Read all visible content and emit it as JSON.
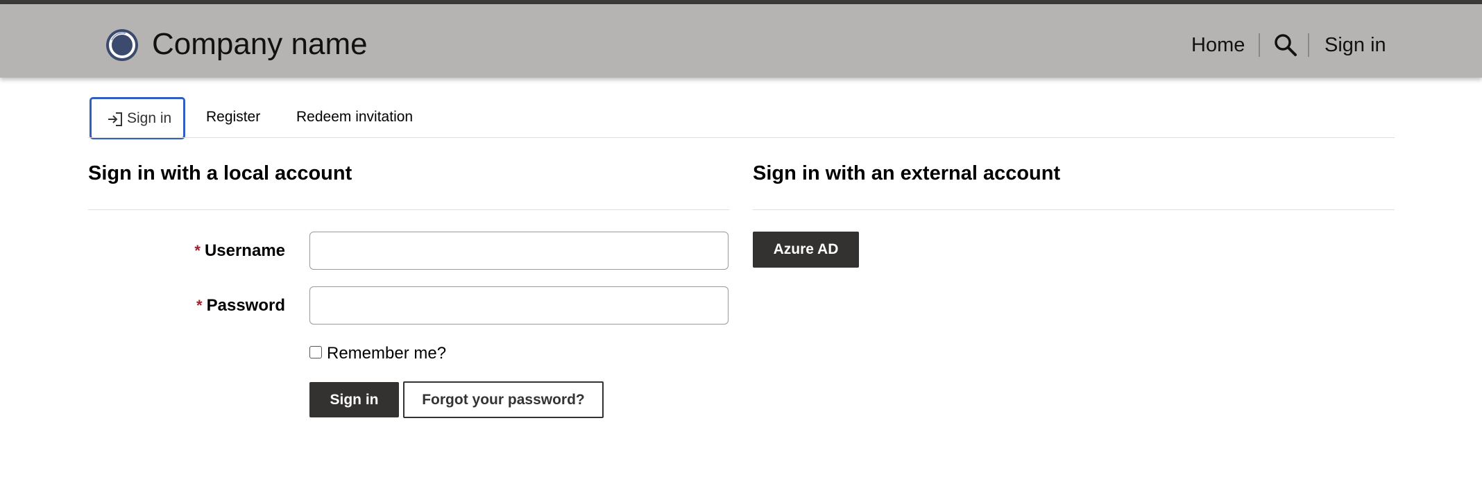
{
  "header": {
    "brand_name": "Company name",
    "nav": {
      "home": "Home",
      "sign_in": "Sign in"
    }
  },
  "tabs": [
    {
      "label": "Sign in",
      "active": true
    },
    {
      "label": "Register",
      "active": false
    },
    {
      "label": "Redeem invitation",
      "active": false
    }
  ],
  "local": {
    "title": "Sign in with a local account",
    "username_label": "Username",
    "password_label": "Password",
    "required_marker": "*",
    "username_value": "",
    "password_value": "",
    "remember_label": "Remember me?",
    "remember_checked": false,
    "sign_in_button": "Sign in",
    "forgot_button": "Forgot your password?"
  },
  "external": {
    "title": "Sign in with an external account",
    "providers": [
      "Azure AD"
    ]
  },
  "colors": {
    "header_bg": "#b5b4b2",
    "accent_border": "#2f60c1",
    "required": "#a4202a",
    "button_dark": "#333230"
  },
  "icons": {
    "logo": "company-logo",
    "search": "search-icon",
    "sign_in_tab": "sign-in-icon"
  }
}
